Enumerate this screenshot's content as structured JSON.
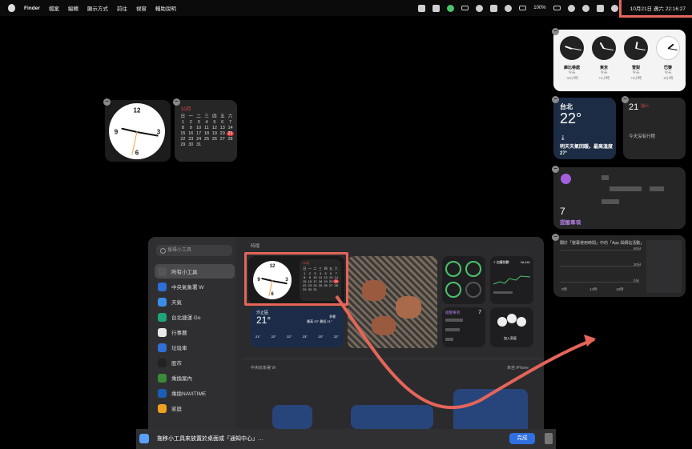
{
  "menubar": {
    "items": [
      "Finder",
      "檔案",
      "編輯",
      "顯示方式",
      "前往",
      "視窗",
      "輔助說明"
    ],
    "battery": "100%",
    "clock": "10月21日 週六  22:16:27"
  },
  "world_clock": {
    "cities": [
      {
        "name": "庫比蒂諾",
        "day": "今天",
        "offset": "-15小時"
      },
      {
        "name": "東京",
        "day": "今天",
        "offset": "+1小時"
      },
      {
        "name": "雪梨",
        "day": "今天",
        "offset": "+3小時"
      },
      {
        "name": "巴黎",
        "day": "今天",
        "offset": "-6小時"
      }
    ]
  },
  "weather": {
    "city": "台北",
    "temp": "22°",
    "summary": "明天天氣回暖。最高溫度 27°"
  },
  "calendar_small": {
    "day": "21",
    "dow": "週六",
    "no_events": "今天沒有行程"
  },
  "reminders": {
    "count": "7",
    "label": "提醒事項"
  },
  "screen_time": {
    "title": "關於「螢幕使用時間」中的「App 與網站活動」",
    "y_ticks": [
      "60分",
      "30分",
      "0分"
    ],
    "x_ticks": [
      "0時",
      "14時",
      "18時"
    ]
  },
  "calendar": {
    "month": "10月",
    "dow": [
      "日",
      "一",
      "二",
      "三",
      "四",
      "五",
      "六"
    ],
    "weeks": [
      [
        "1",
        "2",
        "3",
        "4",
        "5",
        "6",
        "7"
      ],
      [
        "8",
        "9",
        "10",
        "11",
        "12",
        "13",
        "14"
      ],
      [
        "15",
        "16",
        "17",
        "18",
        "19",
        "20",
        "21"
      ],
      [
        "22",
        "23",
        "24",
        "25",
        "26",
        "27",
        "28"
      ],
      [
        "29",
        "30",
        "31",
        "",
        "",
        "",
        ""
      ]
    ],
    "today": "21"
  },
  "gallery": {
    "search_placeholder": "搜尋小工具",
    "section_title": "時鐘",
    "sidebar": [
      {
        "label": "所有小工具",
        "color": "#555"
      },
      {
        "label": "中央氣象署 W",
        "color": "#2d6fd6"
      },
      {
        "label": "天氣",
        "color": "#3c8de8"
      },
      {
        "label": "台北捷運 Go",
        "color": "#1fa37a"
      },
      {
        "label": "行事曆",
        "color": "#e8e8e8"
      },
      {
        "label": "垃圾車",
        "color": "#2f6fd6"
      },
      {
        "label": "股市",
        "color": "#222"
      },
      {
        "label": "乘換案內",
        "color": "#3a8a3a"
      },
      {
        "label": "乘換NAVITIME",
        "color": "#1a5fb4"
      },
      {
        "label": "家庭",
        "color": "#f0a020"
      }
    ],
    "weather_widget": {
      "city": "汐止區",
      "temp": "21°",
      "cond": "多雲",
      "range": "最高 23° 最低 21°",
      "hours": [
        "21°",
        "22°",
        "22°",
        "23°",
        "23°",
        "22°"
      ]
    },
    "stocks": {
      "ticker": "Y 加權指數",
      "value": "16,441"
    },
    "reminders_count": "7",
    "reminders_label": "提醒事項",
    "family_label": "加入家庭",
    "section2_title": "中央氣象署 W",
    "section2_right": "來自 iPhone",
    "hint": "拖移小工具來放置於桌面或「通知中心」…",
    "done": "完成"
  }
}
